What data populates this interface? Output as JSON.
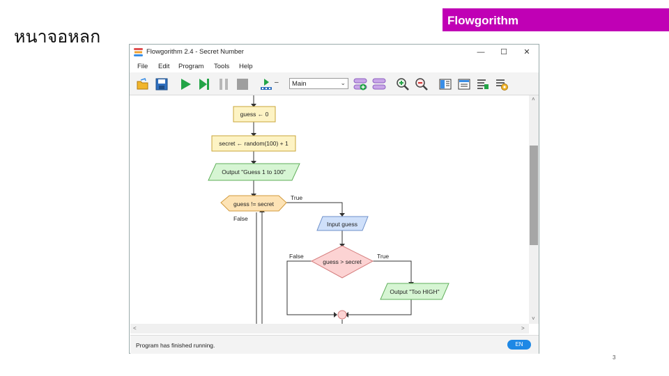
{
  "slide": {
    "title": "หนาจอหลก",
    "brand": "Flowgorithm",
    "page_number": "3",
    "brand_color": "#c000b5"
  },
  "window": {
    "title": "Flowgorithm 2.4 - Secret Number",
    "controls": {
      "minimize": "—",
      "maximize": "☐",
      "close": "✕"
    }
  },
  "menu": [
    "File",
    "Edit",
    "Program",
    "Tools",
    "Help"
  ],
  "toolbar": {
    "icons": [
      "open-folder-icon",
      "save-icon",
      "run-icon",
      "step-icon",
      "pause-icon",
      "stop-icon",
      "speed-icon",
      "add-function-icon",
      "remove-function-icon",
      "zoom-in-icon",
      "zoom-out-icon",
      "layout-icon",
      "variable-watch-icon",
      "console-icon",
      "settings-icon"
    ],
    "speed_label": "–",
    "function_select": "Main"
  },
  "flowchart": {
    "nodes": {
      "assign1": "guess ← 0",
      "assign2": "secret ← random(100) + 1",
      "output1": "Output \"Guess 1 to 100\"",
      "loop": "guess != secret",
      "input": "Input guess",
      "decision": "guess > secret",
      "output2": "Output \"Too HIGH\""
    },
    "labels": {
      "loop_true": "True",
      "loop_false": "False",
      "dec_false": "False",
      "dec_true": "True"
    }
  },
  "scroll": {
    "up": "˄",
    "down": "˅",
    "left": "<",
    "right": ">"
  },
  "status": {
    "text": "Program has finished running.",
    "language": "EN"
  }
}
